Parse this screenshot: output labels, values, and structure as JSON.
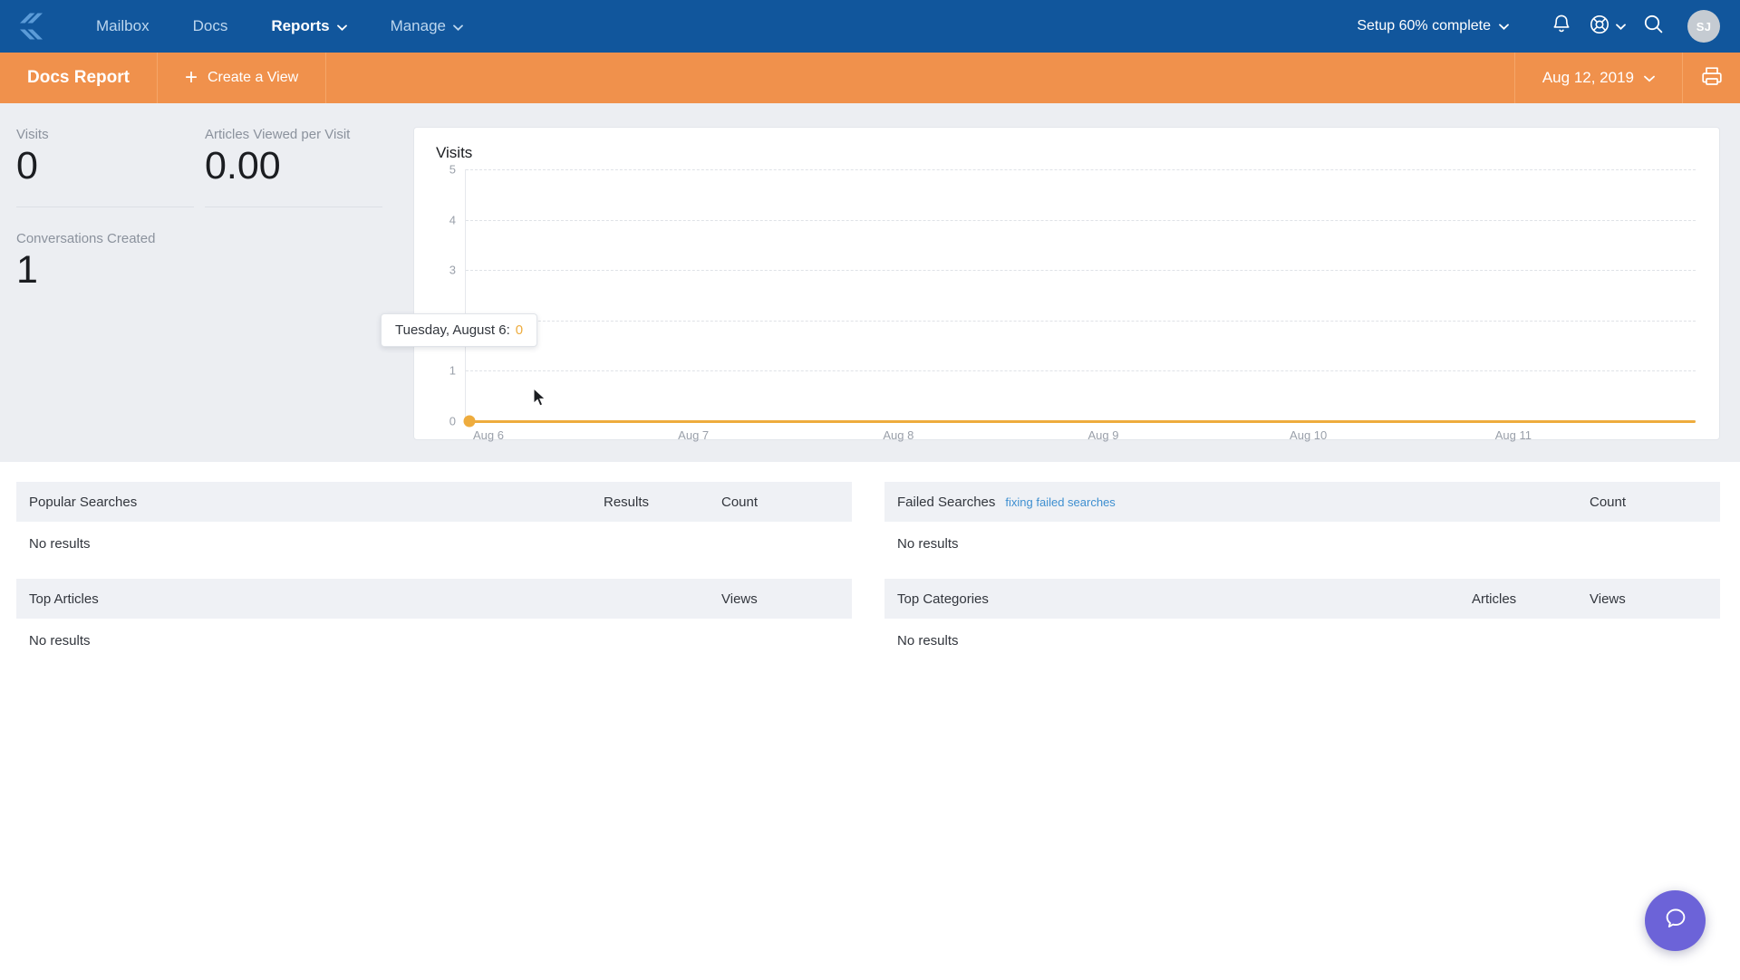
{
  "topnav": {
    "logo_icon": "helpscout-logo-icon",
    "links": [
      {
        "label": "Mailbox",
        "active": false,
        "caret": false
      },
      {
        "label": "Docs",
        "active": false,
        "caret": false
      },
      {
        "label": "Reports",
        "active": true,
        "caret": true
      },
      {
        "label": "Manage",
        "active": false,
        "caret": true
      }
    ],
    "setup_label": "Setup 60% complete",
    "notifications_icon": "bell-icon",
    "help_icon": "lifebuoy-icon",
    "search_icon": "search-icon",
    "avatar_initials": "SJ",
    "bg_color": "#11569c"
  },
  "subheader": {
    "title": "Docs Report",
    "create_view_label": "Create a View",
    "plus_icon": "plus-icon",
    "date_label": "Aug 12, 2019",
    "print_icon": "printer-icon",
    "bg_color": "#f0914c"
  },
  "metrics": [
    {
      "label": "Visits",
      "value": "0"
    },
    {
      "label": "Articles Viewed per Visit",
      "value": "0.00"
    },
    {
      "label": "Conversations Created",
      "value": "1"
    }
  ],
  "chart_data": {
    "type": "line",
    "title": "Visits",
    "xlabel": "",
    "ylabel": "",
    "categories": [
      "Aug 6",
      "Aug 7",
      "Aug 8",
      "Aug 9",
      "Aug 10",
      "Aug 11"
    ],
    "values": [
      0,
      0,
      0,
      0,
      0,
      0
    ],
    "series": [
      {
        "name": "Visits",
        "values": [
          0,
          0,
          0,
          0,
          0,
          0
        ],
        "color": "#eeac3e"
      }
    ],
    "yticks": [
      "5",
      "4",
      "3",
      "2",
      "1",
      "0"
    ],
    "ylim": [
      0,
      5
    ],
    "grid": true,
    "legend": "none",
    "marker_points": [
      0
    ],
    "tooltip": {
      "label": "Tuesday, August 6:",
      "value": "0",
      "value_color": "#eeac3e"
    }
  },
  "tables": {
    "left": [
      {
        "title": "Popular Searches",
        "link": "",
        "columns": [
          "Results",
          "Count"
        ],
        "empty_text": "No results"
      },
      {
        "title": "Top Articles",
        "link": "",
        "columns": [
          "Views"
        ],
        "empty_text": "No results"
      }
    ],
    "right": [
      {
        "title": "Failed Searches",
        "link": "fixing failed searches",
        "columns": [
          "Count"
        ],
        "empty_text": "No results"
      },
      {
        "title": "Top Categories",
        "link": "",
        "columns": [
          "Articles",
          "Views"
        ],
        "empty_text": "No results"
      }
    ]
  },
  "beacon": {
    "icon": "chat-bubble-icon",
    "color": "#6c63d8"
  }
}
